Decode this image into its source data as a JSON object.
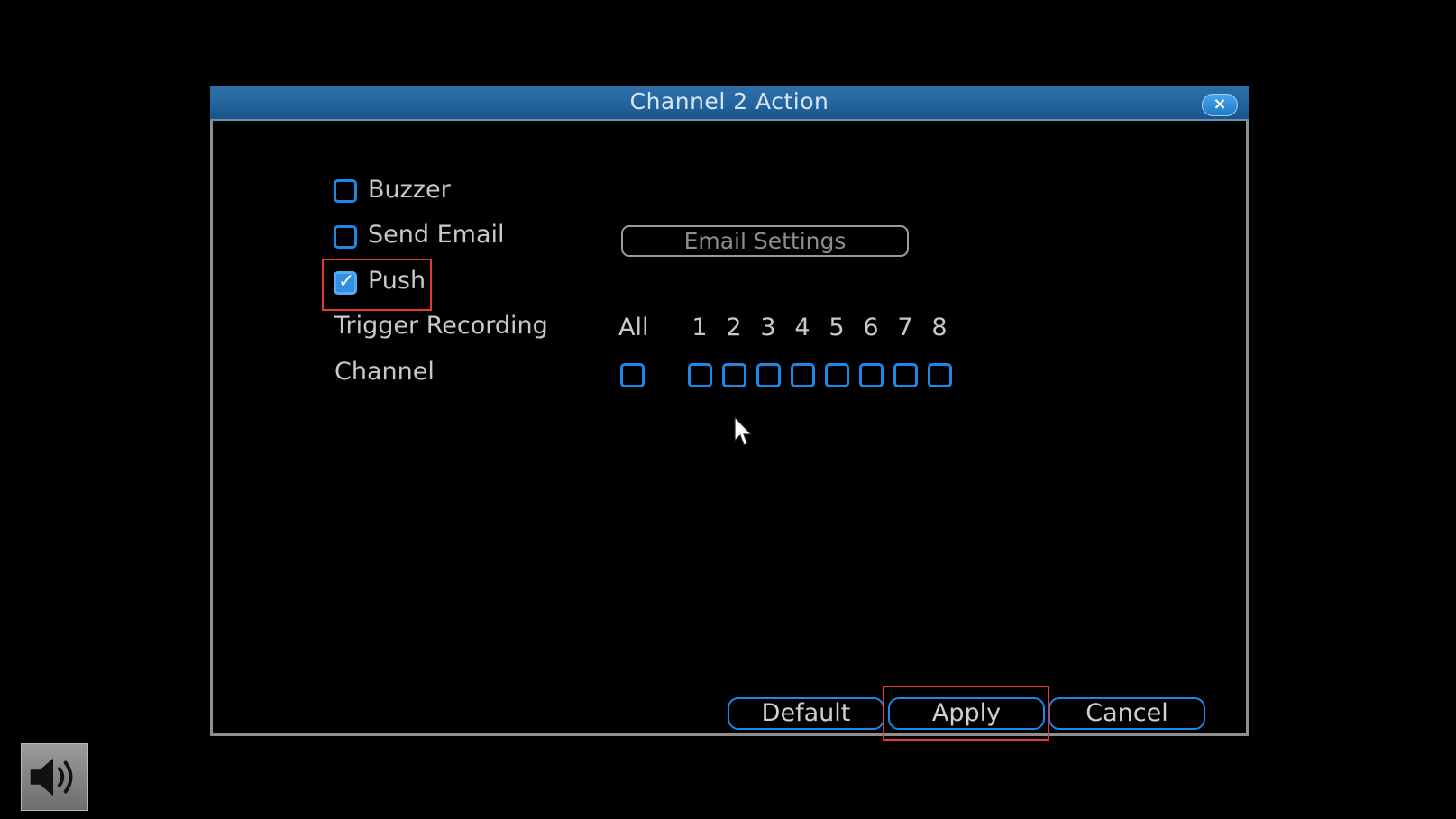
{
  "dialog": {
    "title": "Channel 2 Action",
    "close_label": "×"
  },
  "options": {
    "buzzer": {
      "label": "Buzzer",
      "checked": false
    },
    "send_email": {
      "label": "Send Email",
      "checked": false
    },
    "push": {
      "label": "Push",
      "checked": true
    }
  },
  "email_settings_label": "Email Settings",
  "trigger": {
    "label": "Trigger Recording",
    "channel_label": "Channel",
    "all_label": "All",
    "channels": [
      "1",
      "2",
      "3",
      "4",
      "5",
      "6",
      "7",
      "8"
    ]
  },
  "buttons": {
    "default": "Default",
    "apply": "Apply",
    "cancel": "Cancel"
  },
  "colors": {
    "accent": "#1e88e5",
    "title_bar": "#2667a2",
    "highlight": "#e53935"
  },
  "icons": {
    "close": "close-icon",
    "check": "checkmark-icon",
    "cursor": "mouse-pointer-icon",
    "volume": "speaker-icon"
  }
}
